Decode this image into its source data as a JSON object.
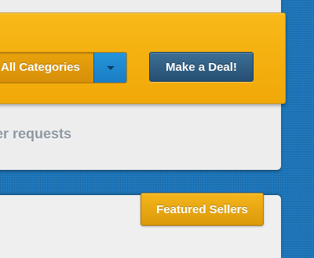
{
  "deal_bar": {
    "category_select": {
      "selected": "All Categories",
      "icon": "chevron-down-icon"
    },
    "make_deal_label": "Make a Deal!"
  },
  "main": {
    "requests_text": "er requests"
  },
  "featured_sellers_label": "Featured Sellers",
  "colors": {
    "background_blue": "#1b74b8",
    "bar_orange": "#f0a808",
    "deal_button_blue": "#2f5f86",
    "dropdown_blue": "#1f88d0",
    "muted_text": "#8e98a2"
  }
}
